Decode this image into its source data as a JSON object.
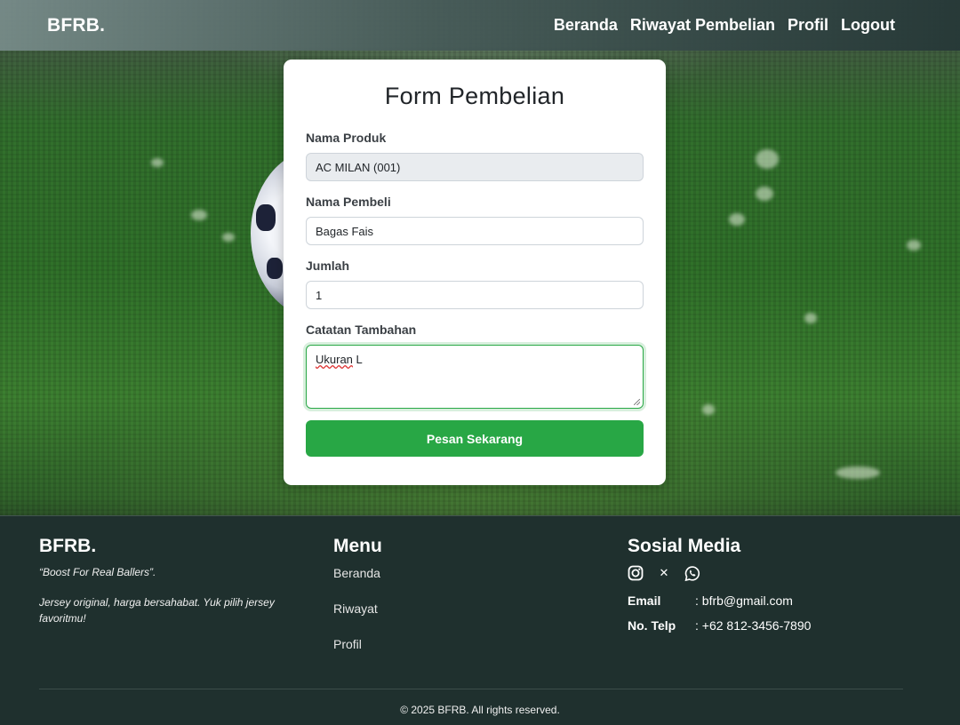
{
  "navbar": {
    "brand": "BFRB.",
    "links": [
      "Beranda",
      "Riwayat Pembelian",
      "Profil",
      "Logout"
    ]
  },
  "form": {
    "title": "Form Pembelian",
    "fields": {
      "product_label": "Nama Produk",
      "product_value": "AC MILAN (001)",
      "buyer_label": "Nama Pembeli",
      "buyer_value": "Bagas Fais",
      "qty_label": "Jumlah",
      "qty_value": "1",
      "notes_label": "Catatan Tambahan",
      "notes_value_word1": "Ukuran",
      "notes_value_word2": " L"
    },
    "submit_label": "Pesan Sekarang"
  },
  "footer": {
    "brand": "BFRB.",
    "tagline": "“Boost For Real Ballers”.",
    "description": "Jersey original, harga bersahabat. Yuk pilih jersey favoritmu!",
    "menu_title": "Menu",
    "menu_items": [
      "Beranda",
      "Riwayat",
      "Profil"
    ],
    "social_title": "Sosial Media",
    "social_icons": [
      "instagram-icon",
      "x-icon",
      "whatsapp-icon"
    ],
    "x_glyph": "✕",
    "contacts": [
      {
        "key": "Email",
        "value": ": bfrb@gmail.com"
      },
      {
        "key": "No. Telp",
        "value": ": +62 812-3456-7890"
      }
    ],
    "copyright": "© 2025 BFRB. All rights reserved."
  },
  "colors": {
    "accent": "#28a745",
    "footer_bg": "#1f302e"
  }
}
